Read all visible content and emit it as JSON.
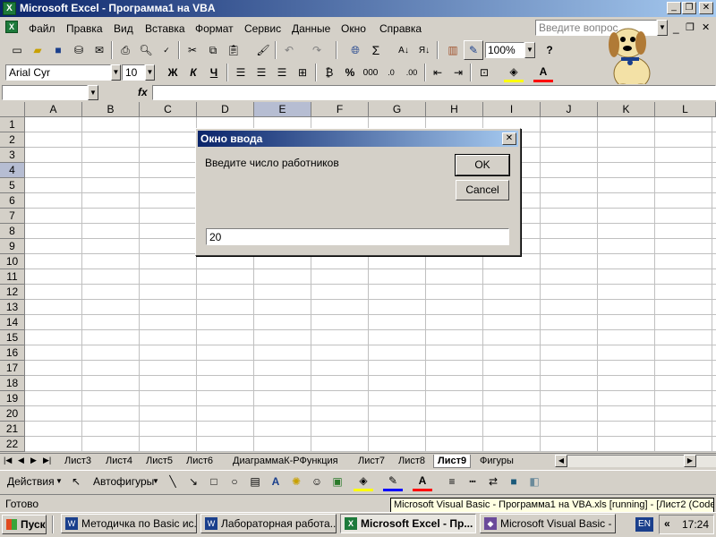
{
  "window": {
    "title": "Microsoft Excel - Программа1 на VBA",
    "min": "_",
    "max": "❐",
    "close": "✕"
  },
  "menu": {
    "items": [
      "Файл",
      "Правка",
      "Вид",
      "Вставка",
      "Формат",
      "Сервис",
      "Данные",
      "Окно",
      "Справка"
    ],
    "help_placeholder": "Введите вопрос"
  },
  "toolbar": {
    "zoom": "100%",
    "sigma": "Σ"
  },
  "format_bar": {
    "font": "Arial Cyr",
    "size": "10",
    "bold": "Ж",
    "italic": "К",
    "underline": "Ч",
    "percent": "%",
    "thousands": "000"
  },
  "formula_bar": {
    "name_box": "",
    "fx": "fx",
    "value": ""
  },
  "columns": [
    "A",
    "B",
    "C",
    "D",
    "E",
    "F",
    "G",
    "H",
    "I",
    "J",
    "K",
    "L"
  ],
  "rows": [
    "1",
    "2",
    "3",
    "4",
    "5",
    "6",
    "7",
    "8",
    "9",
    "10",
    "11",
    "12",
    "13",
    "14",
    "15",
    "16",
    "17",
    "18",
    "19",
    "20",
    "21",
    "22"
  ],
  "dialog": {
    "title": "Окно ввода",
    "prompt": "Введите число работников",
    "ok": "OK",
    "cancel": "Cancel",
    "value": "20",
    "close": "✕"
  },
  "sheets": {
    "tabs": [
      "Лист3",
      "Лист4",
      "Лист5",
      "Лист6",
      "ДиаграммаК-РФункция",
      "Лист7",
      "Лист8",
      "Лист9",
      "Фигуры"
    ],
    "active": "Лист9"
  },
  "drawing": {
    "actions": "Действия",
    "autoshapes": "Автофигуры"
  },
  "status": {
    "text": "Готово",
    "tooltip": "Microsoft Visual Basic - Программа1 на VBA.xls [running] - [Лист2 (Code)]"
  },
  "taskbar": {
    "start": "Пуск",
    "tasks": [
      "Методичка по Basic ис...",
      "Лабораторная работа...",
      "Microsoft Excel - Пр...",
      "Microsoft Visual Basic - ..."
    ],
    "lang": "EN",
    "chevron": "«",
    "clock": "17:24"
  },
  "colors": {
    "titlebar_start": "#0a246a",
    "titlebar_end": "#a6caf0",
    "selected_header": "#b6bdd2",
    "active_tab": "#ffffff"
  }
}
